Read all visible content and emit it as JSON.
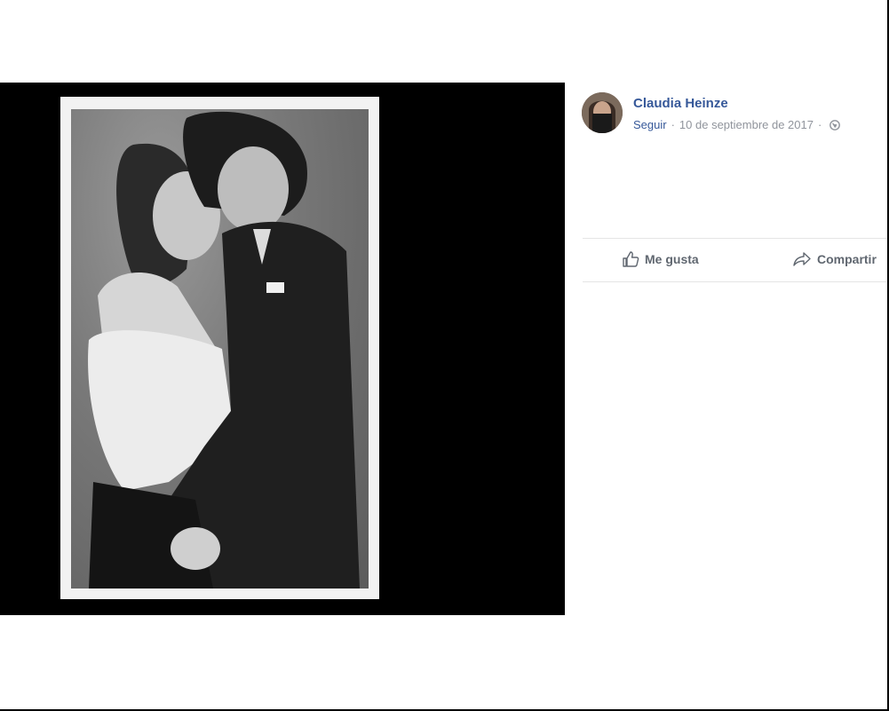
{
  "post": {
    "author_name": "Claudia Heinze",
    "follow_label": "Seguir",
    "separator": "·",
    "date": "10 de septiembre de 2017",
    "audience_icon": "globe-icon"
  },
  "actions": {
    "like_label": "Me gusta",
    "like_icon": "thumbs-up-icon",
    "share_label": "Compartir",
    "share_icon": "share-arrow-icon"
  },
  "colors": {
    "link": "#365899",
    "meta": "#90949c",
    "action": "#606770",
    "stage": "#000000"
  }
}
